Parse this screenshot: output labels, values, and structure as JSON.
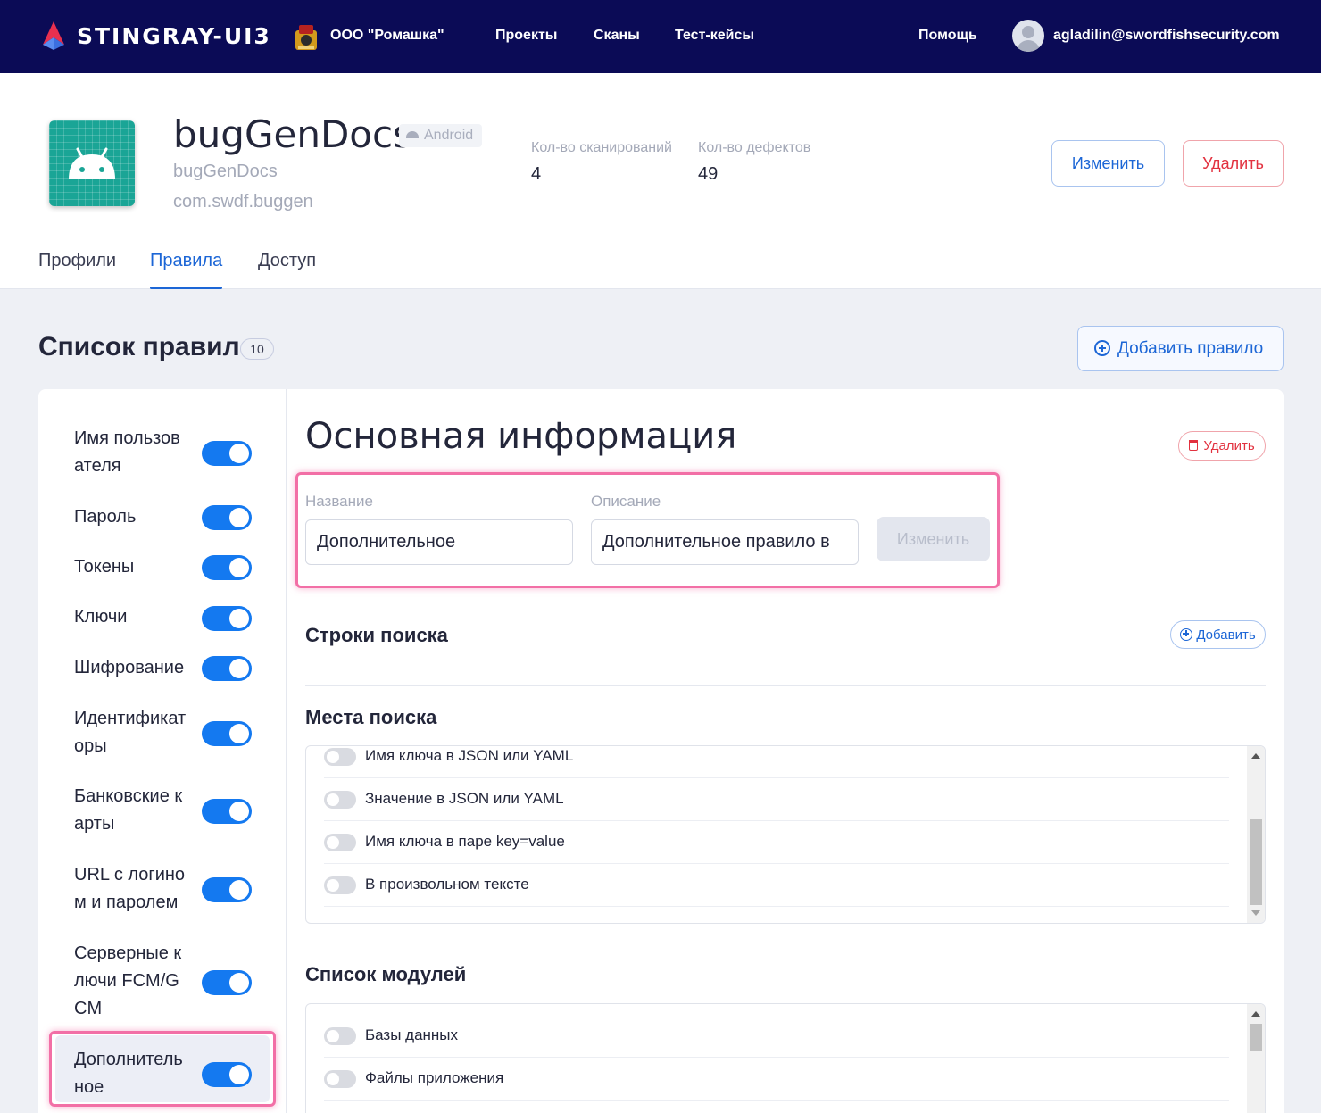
{
  "navbar": {
    "brand": "STINGRAY-UI3",
    "org": "ООО \"Ромашка\"",
    "links": [
      "Проекты",
      "Сканы",
      "Тест-кейсы"
    ],
    "help": "Помощь",
    "user_email": "agladilin@swordfishsecurity.com",
    "colors": {
      "background": "#0b0b56",
      "logo_red": "#e8304f",
      "logo_blue": "#3b6fe0"
    }
  },
  "app": {
    "title": "bugGenDocs",
    "platform": "Android",
    "name": "bugGenDocs",
    "package": "com.swdf.buggen",
    "stats": [
      {
        "label": "Кол-во сканирований",
        "value": "4"
      },
      {
        "label": "Кол-во дефектов",
        "value": "49"
      }
    ],
    "edit_label": "Изменить",
    "delete_label": "Удалить",
    "tabs": [
      {
        "label": "Профили",
        "active": false
      },
      {
        "label": "Правила",
        "active": true
      },
      {
        "label": "Доступ",
        "active": false
      }
    ]
  },
  "rules": {
    "title": "Список правил",
    "count": "10",
    "add_label": "Добавить правило",
    "items": [
      {
        "label": "Имя пользов ателя",
        "enabled": true
      },
      {
        "label": "Пароль",
        "enabled": true
      },
      {
        "label": "Токены",
        "enabled": true
      },
      {
        "label": "Ключи",
        "enabled": true
      },
      {
        "label": "Шифрование",
        "enabled": true
      },
      {
        "label": "Идентификат оры",
        "enabled": true
      },
      {
        "label": "Банковские к арты",
        "enabled": true
      },
      {
        "label": "URL с логино м и паролем",
        "enabled": true
      },
      {
        "label": "Серверные к лючи FCM/G CM",
        "enabled": true
      },
      {
        "label": "Дополнитель ное",
        "enabled": true,
        "selected": true
      }
    ]
  },
  "detail": {
    "title": "Основная информация",
    "delete_label": "Удалить",
    "name_label": "Название",
    "name_value": "Дополнительное",
    "description_label": "Описание",
    "description_value": "Дополнительное правило в",
    "save_label": "Изменить",
    "search_strings_title": "Строки поиска",
    "add_label": "Добавить",
    "search_places_title": "Места поиска",
    "search_places": [
      {
        "label": "Имя ключа в JSON или YAML",
        "enabled": false
      },
      {
        "label": "Значение в JSON или YAML",
        "enabled": false
      },
      {
        "label": "Имя ключа в паре key=value",
        "enabled": false
      },
      {
        "label": "В произвольном тексте",
        "enabled": false
      }
    ],
    "modules_title": "Список модулей",
    "modules": [
      {
        "label": "Базы данных",
        "enabled": false
      },
      {
        "label": "Файлы приложения",
        "enabled": false
      }
    ],
    "colors": {
      "accent": "#1c66d6",
      "toggle_on": "#1479f0",
      "danger": "#e2313f",
      "highlight": "#f26fa6"
    }
  }
}
